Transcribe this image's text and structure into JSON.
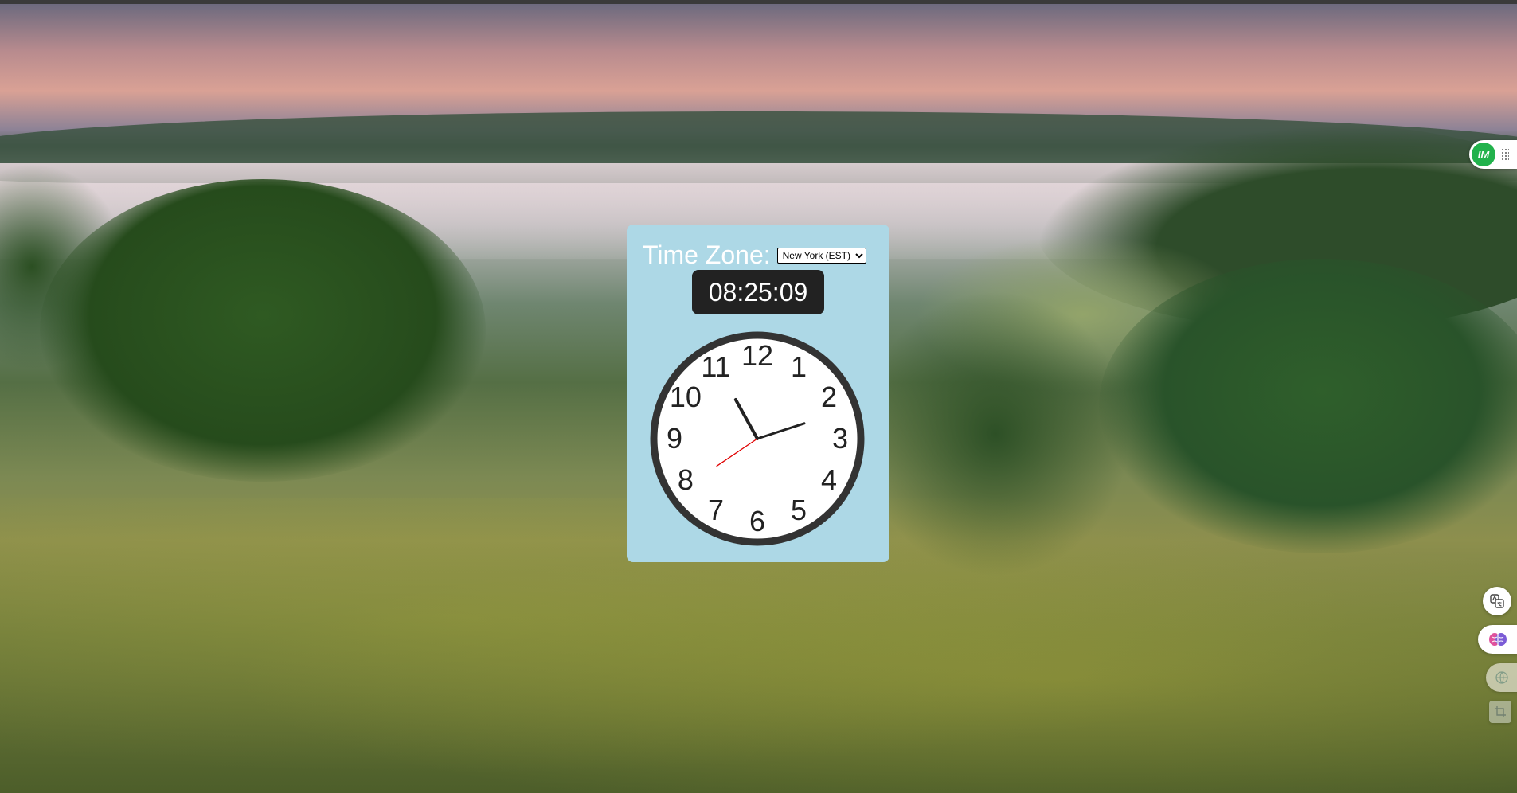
{
  "widget": {
    "tz_label": "Time Zone:",
    "tz_selected": "New York (EST)",
    "digital_time": "08:25:09",
    "clock": {
      "hour": 8,
      "minute": 25,
      "second": 9,
      "numerals": [
        "12",
        "1",
        "2",
        "3",
        "4",
        "5",
        "6",
        "7",
        "8",
        "9",
        "10",
        "11"
      ]
    }
  },
  "extensions": {
    "im_badge": "IM"
  },
  "colors": {
    "widget_bg": "#add8e6",
    "digital_bg": "#222222",
    "second_hand": "#e00000"
  }
}
